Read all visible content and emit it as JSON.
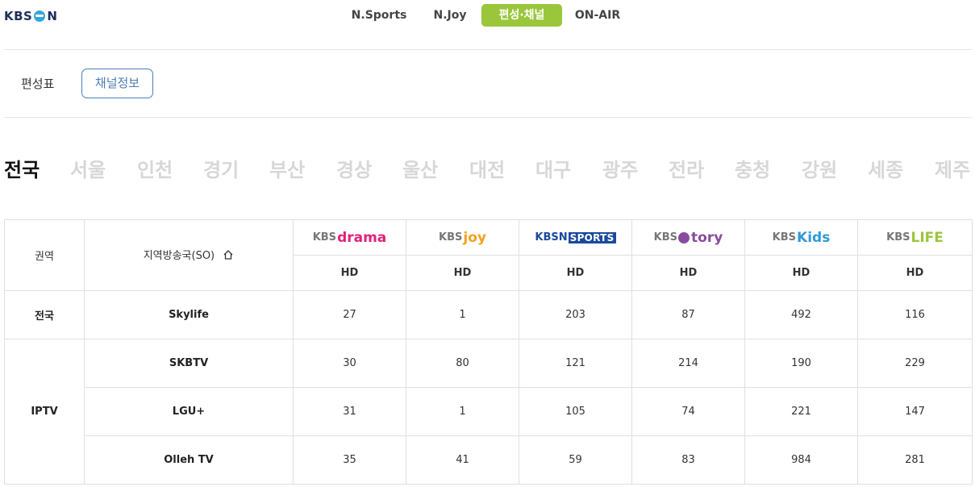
{
  "logo": {
    "kbs": "KBS",
    "n": "N"
  },
  "topnav": [
    {
      "label": "N.Sports",
      "active": false
    },
    {
      "label": "N.Joy",
      "active": false
    },
    {
      "label": "편성·채널",
      "active": true
    },
    {
      "label": "ON-AIR",
      "active": false
    }
  ],
  "subtabs": {
    "schedule": "편성표",
    "channel_info": "채널정보"
  },
  "regions": [
    "전국",
    "서울",
    "인천",
    "경기",
    "부산",
    "경상",
    "울산",
    "대전",
    "대구",
    "광주",
    "전라",
    "충청",
    "강원",
    "세종",
    "제주"
  ],
  "active_region": "전국",
  "table": {
    "col_region": "권역",
    "col_so": "지역방송국(SO)",
    "channels": [
      {
        "kbs": "KBS",
        "brand": "drama",
        "color": "#e3207a",
        "quality": "HD"
      },
      {
        "kbs": "KBS",
        "brand": "joy",
        "color": "#f3a11b",
        "quality": "HD"
      },
      {
        "kbs": "KBSN",
        "brand": "SPORTS",
        "color": "#1a4a9c",
        "quality": "HD"
      },
      {
        "kbs": "KBS",
        "brand": "tory",
        "color": "#8a4b9e",
        "quality": "HD"
      },
      {
        "kbs": "KBS",
        "brand": "Kids",
        "color": "#2e9ad8",
        "quality": "HD"
      },
      {
        "kbs": "KBS",
        "brand": "LIFE",
        "color": "#9ac63b",
        "quality": "HD"
      }
    ],
    "groups": [
      {
        "name": "전국",
        "rows": [
          {
            "so": "Skylife",
            "values": [
              "27",
              "1",
              "203",
              "87",
              "492",
              "116"
            ]
          }
        ]
      },
      {
        "name": "IPTV",
        "rows": [
          {
            "so": "SKBTV",
            "values": [
              "30",
              "80",
              "121",
              "214",
              "190",
              "229"
            ]
          },
          {
            "so": "LGU+",
            "values": [
              "31",
              "1",
              "105",
              "74",
              "221",
              "147"
            ]
          },
          {
            "so": "Olleh TV",
            "values": [
              "35",
              "41",
              "59",
              "83",
              "984",
              "281"
            ]
          }
        ]
      }
    ]
  },
  "icons": {
    "home": "home-icon"
  }
}
